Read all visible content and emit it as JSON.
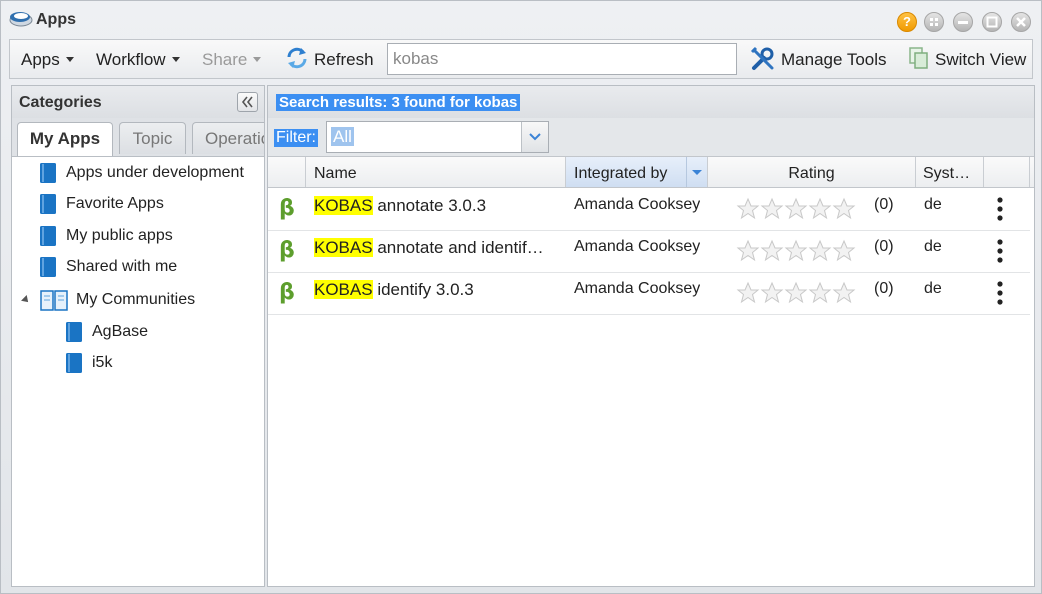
{
  "window": {
    "title": "Apps"
  },
  "toolbar": {
    "apps_label": "Apps",
    "workflow_label": "Workflow",
    "share_label": "Share",
    "refresh_label": "Refresh",
    "search_value": "kobas",
    "manage_tools_label": "Manage Tools",
    "switch_view_label": "Switch View"
  },
  "categories": {
    "title": "Categories",
    "tabs": [
      "My Apps",
      "Topic",
      "Operation"
    ],
    "items": [
      {
        "label": "Apps under development"
      },
      {
        "label": "Favorite Apps"
      },
      {
        "label": "My public apps"
      },
      {
        "label": "Shared with me"
      },
      {
        "label": "My Communities"
      },
      {
        "label": "AgBase"
      },
      {
        "label": "i5k"
      }
    ]
  },
  "results": {
    "summary": "Search results: 3 found for kobas",
    "filter_label": "Filter:",
    "filter_value": "All",
    "columns": [
      "Name",
      "Integrated by",
      "Rating",
      "Syst…"
    ],
    "rows": [
      {
        "badge": "β",
        "name_highlight": "KOBAS",
        "name_rest": " annotate 3.0.3",
        "integrator": "Amanda Cooksey",
        "rating": 0,
        "rating_count": "(0)",
        "system": "de"
      },
      {
        "badge": "β",
        "name_highlight": "KOBAS",
        "name_rest": " annotate and identif…",
        "integrator": "Amanda Cooksey",
        "rating": 0,
        "rating_count": "(0)",
        "system": "de"
      },
      {
        "badge": "β",
        "name_highlight": "KOBAS",
        "name_rest": " identify 3.0.3",
        "integrator": "Amanda Cooksey",
        "rating": 0,
        "rating_count": "(0)",
        "system": "de"
      }
    ]
  },
  "colors": {
    "selection_blue": "#3c8ff2",
    "highlight_yellow": "#ffff00",
    "beta_green": "#5d9e2d",
    "book_blue": "#1a74c4"
  }
}
